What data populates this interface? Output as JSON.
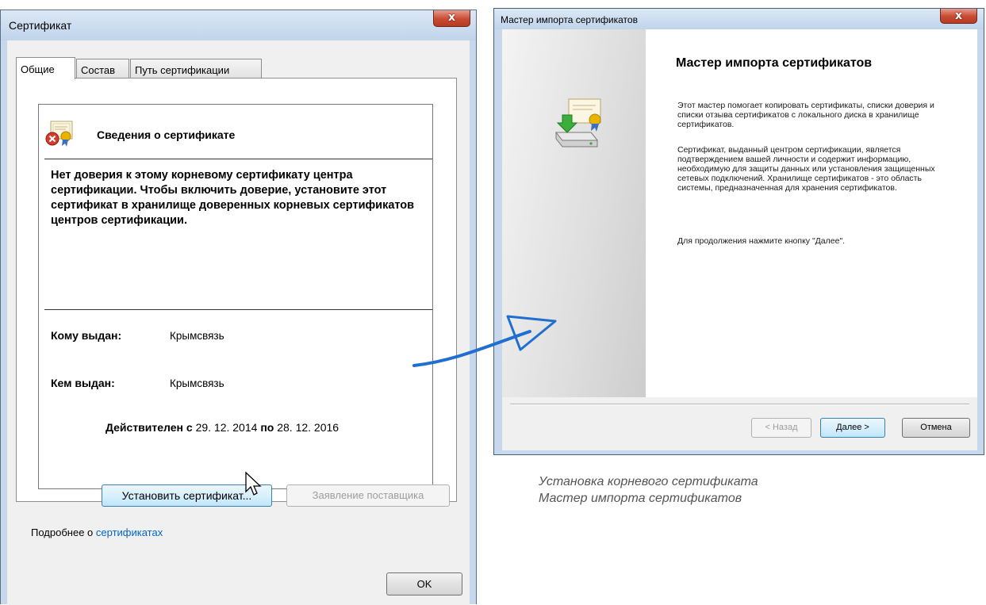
{
  "cert_window": {
    "title": "Сертификат",
    "close_glyph": "x",
    "tabs": [
      {
        "label": "Общие"
      },
      {
        "label": "Состав"
      },
      {
        "label": "Путь сертификации"
      }
    ],
    "info_title": "Сведения о сертификате",
    "warning": "Нет доверия к этому корневому сертификату центра сертификации. Чтобы включить доверие, установите этот сертификат в хранилище доверенных корневых сертификатов центров сертификации.",
    "issued_to_label": "Кому выдан:",
    "issued_to_value": "Крымсвязь",
    "issued_by_label": "Кем выдан:",
    "issued_by_value": "Крымсвязь",
    "valid_from_label": "Действителен с",
    "valid_from": "29. 12. 2014",
    "valid_to_label": "по",
    "valid_to": "28. 12. 2016",
    "install_button": "Установить сертификат...",
    "issuer_statement_button": "Заявление поставщика",
    "more_prefix": "Подробнее о",
    "more_link": "сертификатах",
    "ok_button": "OK"
  },
  "wizard_window": {
    "title": "Мастер импорта сертификатов",
    "close_glyph": "x",
    "heading": "Мастер импорта сертификатов",
    "paragraph1": "Этот мастер помогает копировать сертификаты, списки доверия и списки отзыва сертификатов с локального диска в хранилище сертификатов.",
    "paragraph2": "Сертификат, выданный центром сертификации, является подтверждением вашей личности и содержит информацию, необходимую для защиты данных или установления защищенных сетевых подключений. Хранилище сертификатов - это область системы, предназначенная для хранения сертификатов.",
    "paragraph3": "Для продолжения нажмите кнопку \"Далее\".",
    "back_button": "< Назад",
    "next_button": "Далее >",
    "cancel_button": "Отмена"
  },
  "caption": {
    "line1": "Установка корневого сертификата",
    "line2": "Мастер импорта сертификатов"
  },
  "colors": {
    "window_frame": "#c7d8ec",
    "close_button": "#c74a33",
    "link": "#0066cc",
    "arrow": "#1f6fd0"
  }
}
